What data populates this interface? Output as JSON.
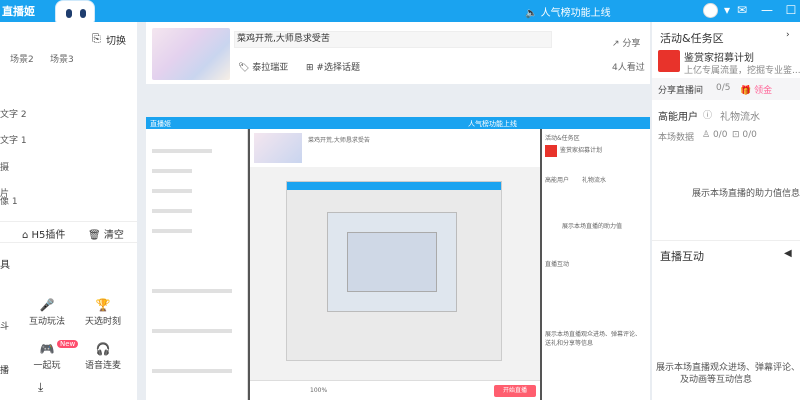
{
  "topbar": {
    "logo": "直播姬",
    "notice": "🔈 人气榜功能上线",
    "icons": [
      "mail-icon",
      "minimize-icon",
      "maximize-icon"
    ],
    "accent": "#1aa3f0"
  },
  "left": {
    "header_left": "",
    "switch_label": "切换",
    "tabs": [
      "场景2",
      "场景3"
    ],
    "items": [
      "文字 2",
      "文字 1",
      "摄",
      "片",
      "像 1",
      "频"
    ],
    "tools": {
      "h5": "H5插件",
      "clear": "清空"
    },
    "section": "具",
    "features": [
      {
        "label": "互动玩法",
        "icon": "mic-icon"
      },
      {
        "label": "天选时刻",
        "icon": "trophy-icon"
      },
      {
        "label": "一起玩",
        "icon": "gamepad-icon"
      },
      {
        "label": "语音连麦",
        "icon": "headset-icon"
      }
    ],
    "new_badge": "New",
    "cut_labels": [
      "斗",
      "播"
    ]
  },
  "center": {
    "topic_title": "菜鸡开荒,大师恳求受苦",
    "chips": {
      "game": "泰拉瑞亚",
      "tag": "#选择话题"
    },
    "share": "分享",
    "watching": "4人看过"
  },
  "stage": {
    "inner_notice": "人气榜功能上线",
    "inner_title": "菜鸡开荒,大师恳求受苦",
    "right_title": "活动&任务区",
    "right_banner": "鉴赏家招募计划",
    "right_tab1": "高能用户",
    "right_tab2": "礼物流水",
    "empty1": "展示本场直播的助力值",
    "interact": "直播互动",
    "empty2": "展示本场直播观众进场、弹幕评论、送礼和分享等信息",
    "start_btn": "开始直播",
    "volume": "100%"
  },
  "right": {
    "activity_title": "活动&任务区",
    "banner_title": "鉴赏家招募计划",
    "banner_sub": "上亿专属流量，挖掘专业鉴...",
    "share_live": "分享直播间",
    "share_count": "0/5",
    "reward": "🎁 领金",
    "tab_active": "高能用户",
    "tab_other": "礼物流水",
    "stats_label": "本场数据",
    "stats_values": [
      "0/0",
      "0/0"
    ],
    "empty_energy": "展示本场直播的助力值信息",
    "interact_title": "直播互动",
    "empty_interact_1": "展示本场直播观众进场、弹幕评论、",
    "empty_interact_2": "及动画等互动信息"
  }
}
